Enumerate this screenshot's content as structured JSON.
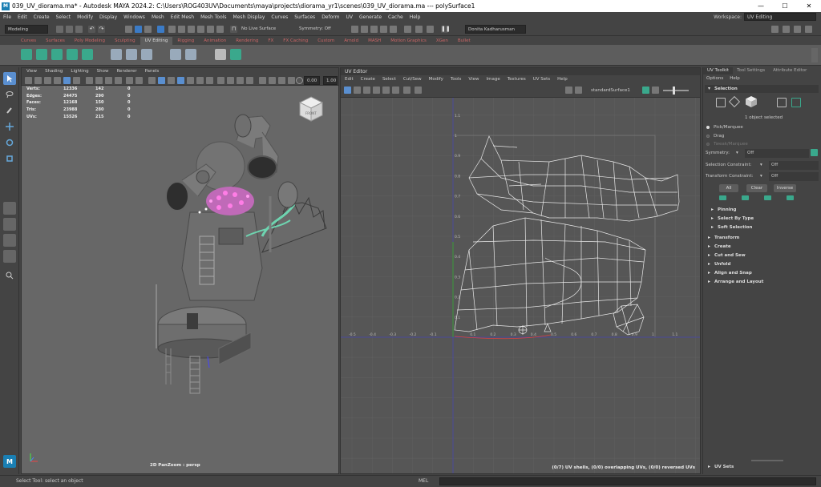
{
  "titlebar": {
    "app_icon": "M",
    "title": "039_UV_diorama.ma* - Autodesk MAYA 2024.2: C:\\Users\\ROG403UV\\Documents\\maya\\projects\\diorama_yr1\\scenes\\039_UV_diorama.ma   ---   polySurface1",
    "minimize": "—",
    "maximize": "☐",
    "close": "✕"
  },
  "menubar": {
    "items": [
      "File",
      "Edit",
      "Create",
      "Select",
      "Modify",
      "Display",
      "Windows",
      "Mesh",
      "Edit Mesh",
      "Mesh Tools",
      "Mesh Display",
      "Curves",
      "Surfaces",
      "Deform",
      "UV",
      "Generate",
      "Cache",
      "Help"
    ],
    "workspace_label": "Workspace:",
    "workspace_value": "UV Editing"
  },
  "statusline": {
    "menuset": "Modeling",
    "live_surface": "No Live Surface",
    "symmetry": "Symmetry: Off",
    "user": "Donita Kadharusman"
  },
  "shelf": {
    "tabs": [
      "Curves",
      "Surfaces",
      "Poly Modeling",
      "Sculpting",
      "UV Editing",
      "Rigging",
      "Animation",
      "Rendering",
      "FX",
      "FX Caching",
      "Custom",
      "Arnold",
      "MASH",
      "Motion Graphics",
      "XGen",
      "Bullet"
    ],
    "active_tab": "UV Editing"
  },
  "viewport": {
    "menu": [
      "View",
      "Shading",
      "Lighting",
      "Show",
      "Renderer",
      "Panels"
    ],
    "field_a": "0.00",
    "field_b": "1.00",
    "hud": [
      {
        "label": "Verts:",
        "a": "12336",
        "b": "142",
        "c": "0"
      },
      {
        "label": "Edges:",
        "a": "24475",
        "b": "290",
        "c": "0"
      },
      {
        "label": "Faces:",
        "a": "12168",
        "b": "150",
        "c": "0"
      },
      {
        "label": "Tris:",
        "a": "23988",
        "b": "280",
        "c": "0"
      },
      {
        "label": "UVs:",
        "a": "15526",
        "b": "215",
        "c": "0"
      }
    ],
    "viewcube_label": "FRONT",
    "camera_label": "2D PanZoom : persp"
  },
  "uv_editor": {
    "title": "UV Editor",
    "menu": [
      "Edit",
      "Create",
      "Select",
      "Cut/Sew",
      "Modify",
      "Tools",
      "View",
      "Image",
      "Textures",
      "UV Sets",
      "Help"
    ],
    "texture_name": "standardSurface1",
    "h_ticks": [
      "-0.5",
      "-0.4",
      "-0.3",
      "-0.2",
      "-0.1",
      "0.1",
      "0.2",
      "0.3",
      "0.4",
      "0.5",
      "0.6",
      "0.7",
      "0.8",
      "0.9",
      "1",
      "1.1"
    ],
    "v_ticks": [
      "1.1",
      "1",
      "0.9",
      "0.8",
      "0.7",
      "0.6",
      "0.5",
      "0.4",
      "0.3",
      "0.2",
      "0.1"
    ],
    "status": "(0/7) UV shells, (0/0) overlapping UVs, (0/0) reversed UVs"
  },
  "uv_toolkit": {
    "tabs": [
      "UV Toolkit",
      "Tool Settings",
      "Attribute Editor"
    ],
    "menu": [
      "Options",
      "Help"
    ],
    "selection_header": "Selection",
    "selected_text": "1 object selected",
    "radio_pick": "Pick/Marquee",
    "radio_drag": "Drag",
    "radio_tweak": "Tweak/Marquee",
    "symmetry_label": "Symmetry:",
    "symmetry_value": "Off",
    "sel_constraint_label": "Selection Constraint:",
    "sel_constraint_value": "Off",
    "xform_constraint_label": "Transform Constraint:",
    "xform_constraint_value": "Off",
    "btn_all": "All",
    "btn_clear": "Clear",
    "btn_inverse": "Inverse",
    "subsections": [
      "Pinning",
      "Select By Type",
      "Soft Selection"
    ],
    "sections": [
      "Transform",
      "Create",
      "Cut and Sew",
      "Unfold",
      "Align and Snap",
      "Arrange and Layout"
    ],
    "uv_sets": "UV Sets"
  },
  "helpline": {
    "text": "Select Tool: select an object",
    "mel_label": "MEL"
  },
  "colors": {
    "accent": "#3aa88c",
    "viewport_bg": "#676767",
    "uv_bg": "#565656",
    "selection_pink": "#e040c0"
  }
}
